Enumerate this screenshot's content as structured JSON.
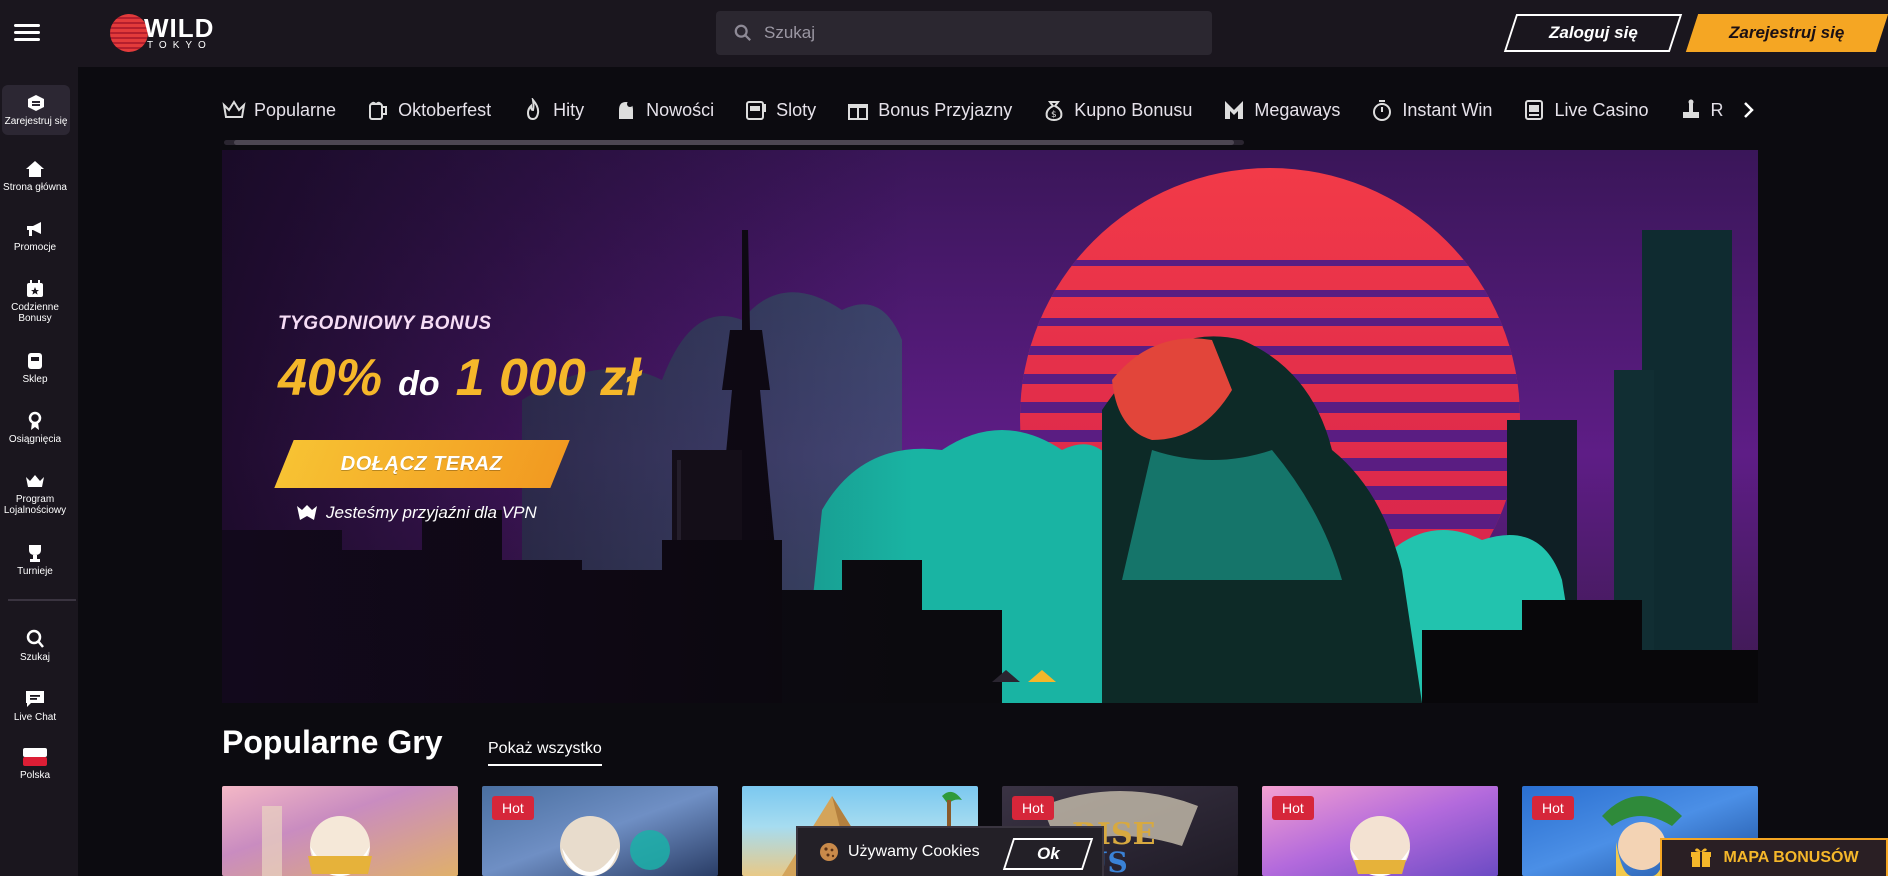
{
  "header": {
    "logo_word": "WILD",
    "logo_sub": "TOKYO",
    "search_placeholder": "Szukaj",
    "login_label": "Zaloguj się",
    "register_label": "Zarejestruj się"
  },
  "sidebar": {
    "items": [
      {
        "label": "Zarejestruj się",
        "icon": "register-icon"
      },
      {
        "label": "Strona główna",
        "icon": "home-icon"
      },
      {
        "label": "Promocje",
        "icon": "megaphone-icon"
      },
      {
        "label": "Codzienne Bonusy",
        "icon": "calendar-star-icon"
      },
      {
        "label": "Sklep",
        "icon": "store-icon"
      },
      {
        "label": "Osiągnięcia",
        "icon": "medal-icon"
      },
      {
        "label": "Program Lojalnościowy",
        "icon": "crown-icon"
      },
      {
        "label": "Turnieje",
        "icon": "trophy-icon"
      },
      {
        "label": "Szukaj",
        "icon": "search-icon"
      },
      {
        "label": "Live Chat",
        "icon": "chat-icon"
      },
      {
        "label": "Polska",
        "icon": "poland-flag-icon"
      }
    ]
  },
  "categories": [
    {
      "label": "Popularne",
      "icon": "crown-icon"
    },
    {
      "label": "Oktoberfest",
      "icon": "beer-mug-icon"
    },
    {
      "label": "Hity",
      "icon": "flame-icon"
    },
    {
      "label": "Nowości",
      "icon": "new-icon"
    },
    {
      "label": "Sloty",
      "icon": "slot-machine-icon"
    },
    {
      "label": "Bonus Przyjazny",
      "icon": "gift-icon"
    },
    {
      "label": "Kupno Bonusu",
      "icon": "money-bag-icon"
    },
    {
      "label": "Megaways",
      "icon": "megaways-icon"
    },
    {
      "label": "Instant Win",
      "icon": "stopwatch-icon"
    },
    {
      "label": "Live Casino",
      "icon": "cards-icon"
    },
    {
      "label": "R",
      "icon": "jackpot-icon"
    }
  ],
  "hero": {
    "headline": "TYGODNIOWY BONUS",
    "percent": "40%",
    "connector": "do",
    "amount": "1 000 zł",
    "cta": "DOŁĄCZ TERAZ",
    "vpn_note": "Jesteśmy przyjaźni dla VPN"
  },
  "popular": {
    "title": "Popularne Gry",
    "show_all": "Pokaż wszystko",
    "tiles": [
      {
        "badge": ""
      },
      {
        "badge": "Hot"
      },
      {
        "badge": ""
      },
      {
        "badge": "Hot"
      },
      {
        "badge": "Hot"
      },
      {
        "badge": "Hot"
      }
    ]
  },
  "cookie": {
    "text": "Używamy Cookies",
    "ok": "Ok"
  },
  "bonus_map": {
    "label": "MAPA BONUSÓW"
  },
  "colors": {
    "accent": "#f5a623",
    "gold": "#f5b72a",
    "badge_red": "#d6263a",
    "panel": "#1a161e",
    "background": "#0c0b10"
  }
}
